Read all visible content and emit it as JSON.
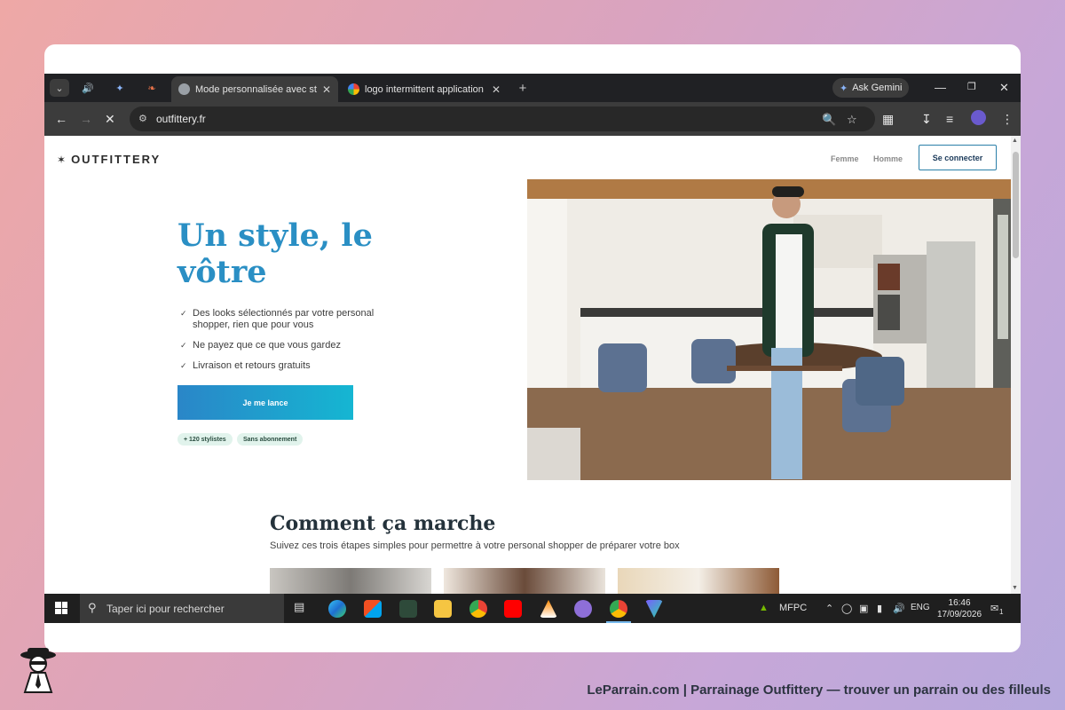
{
  "browser": {
    "tabs": [
      {
        "title": "Mode personnalisée avec style |",
        "active": true
      },
      {
        "title": "logo intermittent application - I",
        "active": false
      }
    ],
    "ask_gemini_label": "Ask Gemini",
    "url": "outfittery.fr"
  },
  "site": {
    "logo_text": "OUTFITTERY",
    "nav": {
      "femme": "Femme",
      "homme": "Homme",
      "login": "Se connecter"
    },
    "hero": {
      "title": "Un style, le vôtre",
      "bullets": [
        "Des looks sélectionnés par votre personal shopper, rien que pour vous",
        "Ne payez que ce que vous gardez",
        "Livraison et retours gratuits"
      ],
      "cta": "Je me lance",
      "badges": [
        "+ 120 stylistes",
        "Sans abonnement"
      ]
    },
    "how": {
      "title": "Comment ça marche",
      "subtitle": "Suivez ces trois étapes simples pour permettre à votre personal shopper de préparer votre box"
    }
  },
  "taskbar": {
    "search_placeholder": "Taper ici pour rechercher",
    "weather_label": "MFPC",
    "lang": "ENG",
    "time": "16:46",
    "date": "17/09/2026",
    "notification_count": "1"
  },
  "footer": {
    "caption": "LeParrain.com | Parrainage Outfittery — trouver un parrain ou des filleuls"
  },
  "colors": {
    "accent": "#2a8fc4",
    "cta_start": "#2a86c8",
    "cta_end": "#15b6d2",
    "badge_bg": "#e1f3ec"
  }
}
